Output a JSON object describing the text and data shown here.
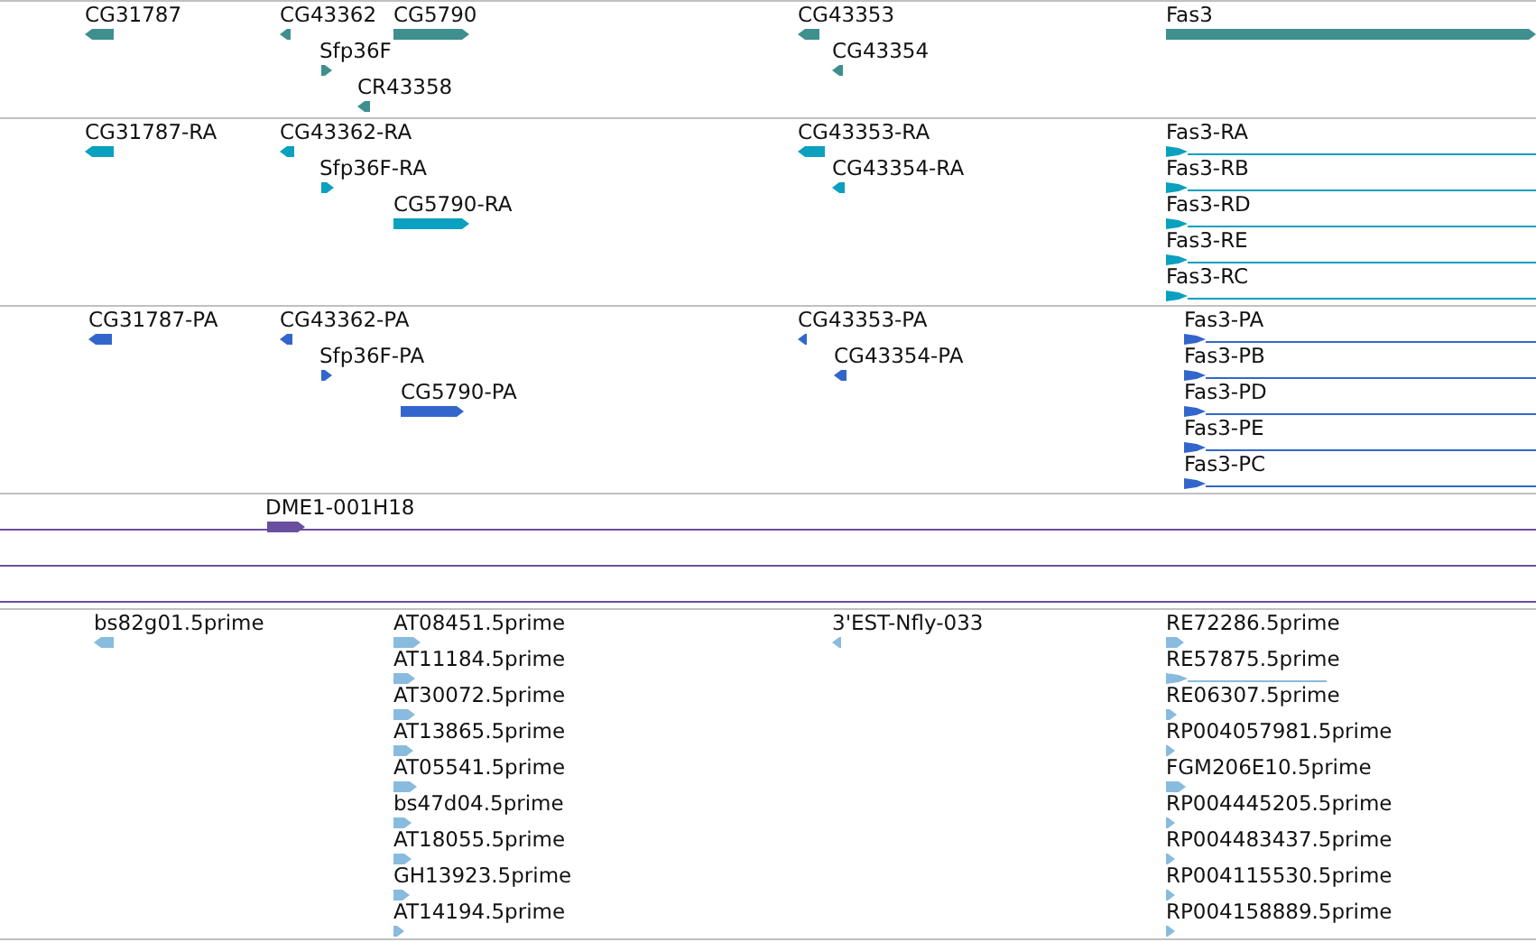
{
  "tracks": [
    {
      "kind": "gene",
      "color": "#3f8f8f",
      "features": [
        {
          "label": "CG31787",
          "forward": false
        },
        {
          "label": "CG43362",
          "forward": false
        },
        {
          "label": "CG5790",
          "forward": true
        },
        {
          "label": "Sfp36F",
          "forward": true
        },
        {
          "label": "CR43358",
          "forward": false
        },
        {
          "label": "CG43353",
          "forward": false
        },
        {
          "label": "CG43354",
          "forward": false
        },
        {
          "label": "Fas3",
          "forward": true
        }
      ]
    },
    {
      "kind": "transcript",
      "color": "#0aa0c0",
      "features": [
        {
          "label": "CG31787-RA",
          "forward": false
        },
        {
          "label": "CG43362-RA",
          "forward": false
        },
        {
          "label": "Sfp36F-RA",
          "forward": true
        },
        {
          "label": "CG5790-RA",
          "forward": true
        },
        {
          "label": "CG43353-RA",
          "forward": false
        },
        {
          "label": "CG43354-RA",
          "forward": false
        },
        {
          "label": "Fas3-RA",
          "forward": true
        },
        {
          "label": "Fas3-RB",
          "forward": true
        },
        {
          "label": "Fas3-RD",
          "forward": true
        },
        {
          "label": "Fas3-RE",
          "forward": true
        },
        {
          "label": "Fas3-RC",
          "forward": true
        }
      ]
    },
    {
      "kind": "protein",
      "color": "#3366cc",
      "features": [
        {
          "label": "CG31787-PA",
          "forward": false
        },
        {
          "label": "CG43362-PA",
          "forward": false
        },
        {
          "label": "Sfp36F-PA",
          "forward": true
        },
        {
          "label": "CG5790-PA",
          "forward": true
        },
        {
          "label": "CG43353-PA",
          "forward": false
        },
        {
          "label": "CG43354-PA",
          "forward": false
        },
        {
          "label": "Fas3-PA",
          "forward": true
        },
        {
          "label": "Fas3-PB",
          "forward": true
        },
        {
          "label": "Fas3-PD",
          "forward": true
        },
        {
          "label": "Fas3-PE",
          "forward": true
        },
        {
          "label": "Fas3-PC",
          "forward": true
        }
      ]
    },
    {
      "kind": "clone",
      "color": "#6a4fa0",
      "features": [
        {
          "label": "DME1-001H18",
          "forward": true
        }
      ]
    },
    {
      "kind": "est",
      "color": "#88bbdd",
      "features": [
        {
          "label": "bs82g01.5prime",
          "forward": false
        },
        {
          "label": "AT08451.5prime",
          "forward": true
        },
        {
          "label": "AT11184.5prime",
          "forward": true
        },
        {
          "label": "AT30072.5prime",
          "forward": true
        },
        {
          "label": "AT13865.5prime",
          "forward": true
        },
        {
          "label": "AT05541.5prime",
          "forward": true
        },
        {
          "label": "bs47d04.5prime",
          "forward": true
        },
        {
          "label": "AT18055.5prime",
          "forward": true
        },
        {
          "label": "GH13923.5prime",
          "forward": true
        },
        {
          "label": "AT14194.5prime",
          "forward": true
        },
        {
          "label": "3'EST-Nfly-033",
          "forward": false
        },
        {
          "label": "RE72286.5prime",
          "forward": true
        },
        {
          "label": "RE57875.5prime",
          "forward": true
        },
        {
          "label": "RE06307.5prime",
          "forward": true
        },
        {
          "label": "RP004057981.5prime",
          "forward": true
        },
        {
          "label": "FGM206E10.5prime",
          "forward": true
        },
        {
          "label": "RP004445205.5prime",
          "forward": true
        },
        {
          "label": "RP004483437.5prime",
          "forward": true
        },
        {
          "label": "RP004115530.5prime",
          "forward": true
        },
        {
          "label": "RP004158889.5prime",
          "forward": true
        }
      ]
    }
  ]
}
